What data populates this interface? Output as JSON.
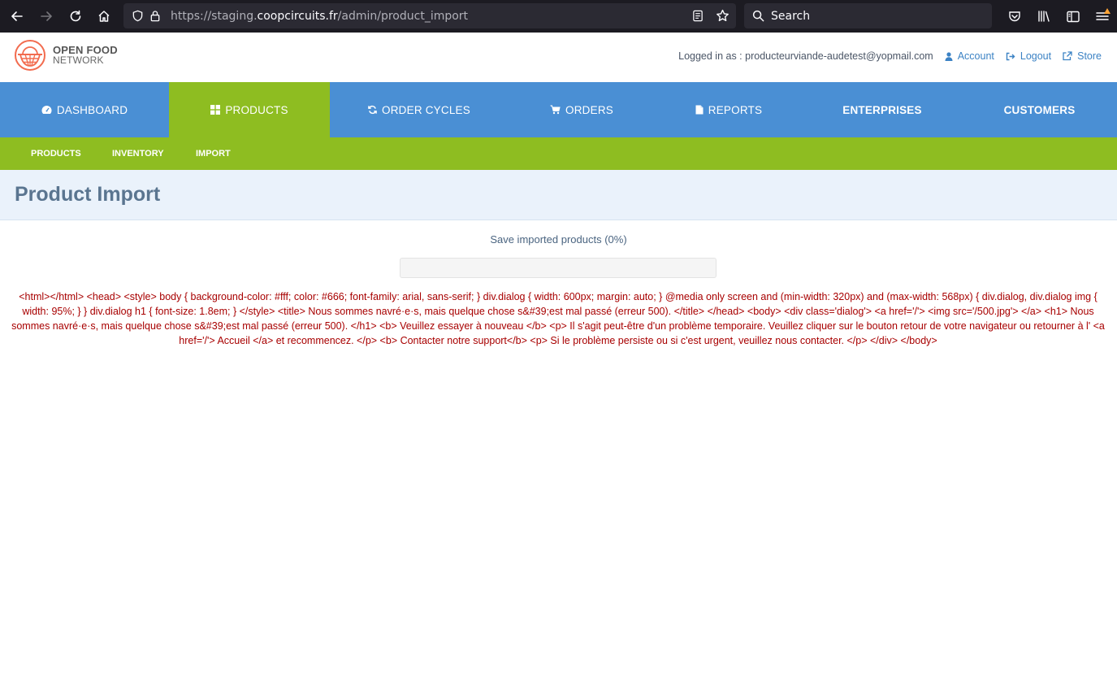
{
  "browser": {
    "url_prefix": "https://staging.",
    "url_host": "coopcircuits.fr",
    "url_path": "/admin/product_import",
    "search_placeholder": "Search"
  },
  "header": {
    "logo_line1": "OPEN FOOD",
    "logo_line2": "NETWORK",
    "logged_in_label": "Logged in as : producteurviande-audetest@yopmail.com",
    "account_label": "Account",
    "logout_label": "Logout",
    "store_label": "Store"
  },
  "main_nav": {
    "dashboard": "Dashboard",
    "products": "Products",
    "order_cycles": "Order Cycles",
    "orders": "Orders",
    "reports": "Reports",
    "enterprises": "Enterprises",
    "customers": "Customers"
  },
  "sub_nav": {
    "products": "Products",
    "inventory": "Inventory",
    "import": "Import"
  },
  "page": {
    "title": "Product Import",
    "save_label": "Save imported products (0%)",
    "progress": 0,
    "error_text": "<html></html> <head> <style> body { background-color: #fff; color: #666; font-family: arial, sans-serif; } div.dialog { width: 600px; margin: auto; } @media only screen and (min-width: 320px) and (max-width: 568px) { div.dialog, div.dialog img { width: 95%; } } div.dialog h1 { font-size: 1.8em; } </style> <title> Nous sommes navré·e·s, mais quelque chose s&#39;est mal passé (erreur 500). </title> </head> <body> <div class='dialog'> <a href='/'> <img src='/500.jpg'> </a> <h1> Nous sommes navré·e·s, mais quelque chose s&#39;est mal passé (erreur 500). </h1> <b> Veuillez essayer à nouveau </b> <p> Il s'agit peut-être d'un problème temporaire. Veuillez cliquer sur le bouton retour de votre navigateur ou retourner à l' <a href='/'> Accueil </a> et recommencez. </p> <b> Contacter notre support</b> <p> Si le problème persiste ou si c'est urgent, veuillez nous contacter. </p> </div> </body>"
  },
  "colors": {
    "nav_blue": "#4a8fd4",
    "accent_green": "#8ebd21",
    "error_red": "#a80000",
    "title_blue": "#5a7590"
  }
}
